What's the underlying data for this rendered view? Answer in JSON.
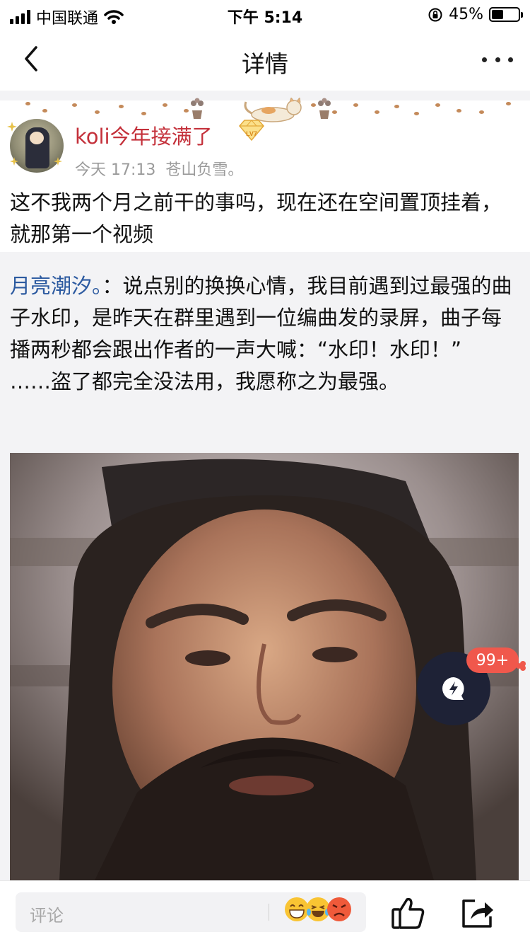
{
  "status_bar": {
    "carrier": "中国联通",
    "time": "下午 5:14",
    "battery_percent": "45%",
    "battery_level": 0.45
  },
  "nav": {
    "title": "详情",
    "back_icon": "chevron-left-icon",
    "more_icon": "more-dots-icon"
  },
  "post": {
    "username": "koli今年接满了",
    "level_badge": "LV7",
    "timestamp": "今天 17:13",
    "source": "苍山负雪。",
    "body": "这不我两个月之前干的事吗，现在还在空间置顶挂着，就那第一个视频"
  },
  "quote": {
    "author": "月亮潮汐。",
    "separator": "：",
    "text": "说点别的换换心情，我目前遇到过最强的曲子水印，是昨天在群里遇到一位编曲发的录屏，曲子每播两秒都会跟出作者的一声大喊：“水印！水印！”",
    "text_line2": "……盗了都完全没法用，我愿称之为最强。"
  },
  "float": {
    "badge": "99+",
    "icon": "lightning-chat-icon"
  },
  "bottom_bar": {
    "comment_placeholder": "评论",
    "emoji_icons": [
      "grinning-emoji-icon",
      "laughing-tears-emoji-icon",
      "angry-emoji-icon"
    ],
    "like_icon": "thumbs-up-icon",
    "share_icon": "share-icon"
  },
  "colors": {
    "username": "#c4303a",
    "quote_author": "#2c5aa0",
    "badge": "#f0584c",
    "float_button": "#1e2236",
    "section_bg": "#f3f3f5"
  }
}
